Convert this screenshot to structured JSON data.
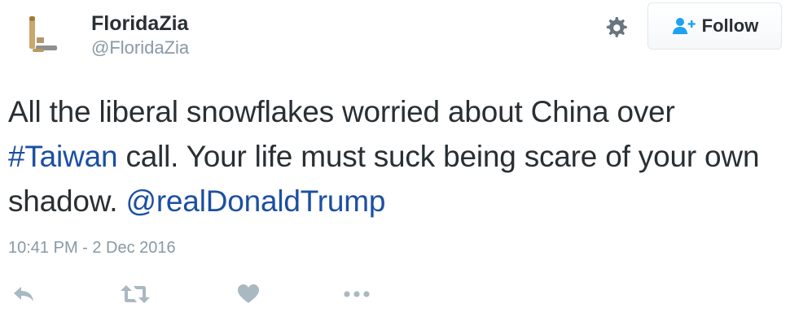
{
  "user": {
    "display_name": "FloridaZia",
    "screen_name": "@FloridaZia"
  },
  "header": {
    "settings_icon": "gear-icon",
    "follow_label": "Follow",
    "follow_icon": "follow-user-icon"
  },
  "tweet": {
    "text_parts": {
      "p1": "All the liberal snowflakes worried about China over ",
      "hashtag": "#Taiwan",
      "p2": " call.  Your life must suck being scare of your own shadow. ",
      "mention": "@realDonaldTrump"
    },
    "timestamp": "10:41 PM - 2 Dec 2016"
  },
  "actions": {
    "icons": [
      "reply-icon",
      "retweet-icon",
      "like-icon",
      "more-icon"
    ]
  },
  "colors": {
    "link": "#1b4fa3",
    "muted": "#8899a6",
    "text": "#292f33"
  }
}
